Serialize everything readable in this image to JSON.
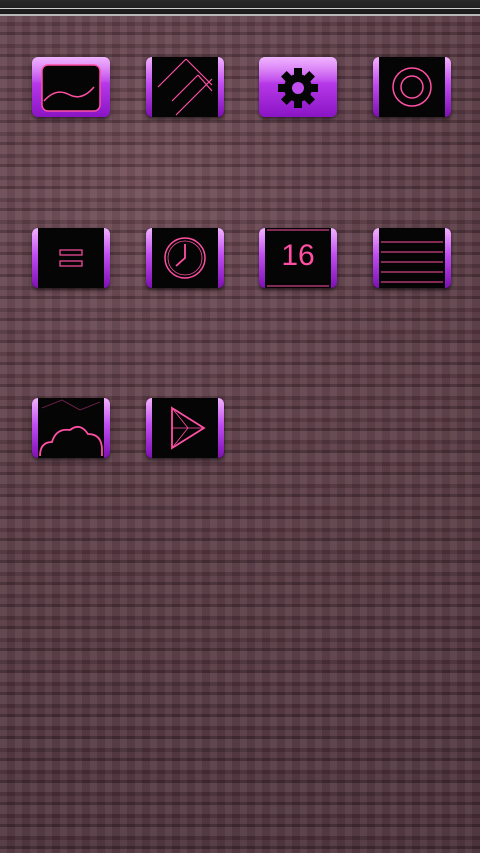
{
  "home_screen": {
    "icons": [
      {
        "name": "gallery-app",
        "icon": "landscape-icon",
        "style": "purple"
      },
      {
        "name": "tangram-app",
        "icon": "tangram-icon",
        "style": "black"
      },
      {
        "name": "settings-app",
        "icon": "gear-icon",
        "style": "purple"
      },
      {
        "name": "camera-app",
        "icon": "target-circle-icon",
        "style": "black"
      },
      {
        "name": "menu-app",
        "icon": "equals-icon",
        "style": "black"
      },
      {
        "name": "clock-app",
        "icon": "clock-icon",
        "style": "black"
      },
      {
        "name": "calendar-app",
        "icon": "calendar-icon",
        "style": "black"
      },
      {
        "name": "notes-app",
        "icon": "lined-paper-icon",
        "style": "black"
      },
      {
        "name": "cloud-app",
        "icon": "cloud-icon",
        "style": "black"
      },
      {
        "name": "play-store-app",
        "icon": "play-icon",
        "style": "black"
      }
    ],
    "calendar_day": "16"
  },
  "colors": {
    "accent_pink": "#ff4fa3",
    "accent_purple": "#b638e8",
    "wallpaper": "#5a3a44"
  }
}
